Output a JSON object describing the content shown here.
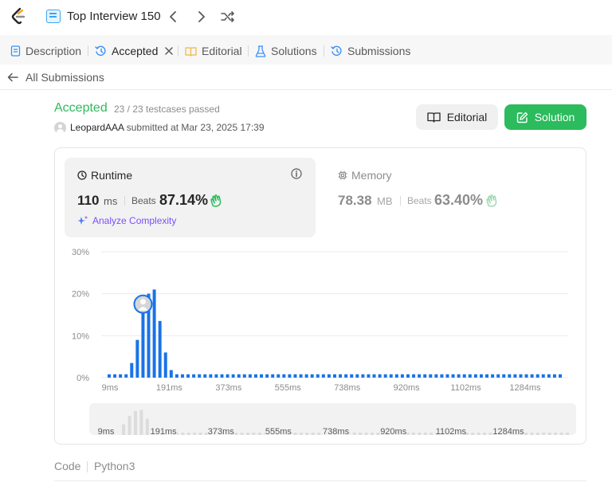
{
  "header": {
    "list_title": "Top Interview 150"
  },
  "tabs": [
    {
      "label": "Description",
      "color": "#3b8ff5"
    },
    {
      "label": "Accepted",
      "color": "#3b8ff5"
    },
    {
      "label": "Editorial",
      "color": "#f5b441"
    },
    {
      "label": "Solutions",
      "color": "#3b8ff5"
    },
    {
      "label": "Submissions",
      "color": "#3b8ff5"
    }
  ],
  "subbar": {
    "back_label": "All Submissions"
  },
  "result": {
    "status": "Accepted",
    "testcases": "23 / 23 testcases passed",
    "username": "LeopardAAA",
    "submitted": "submitted at Mar 23, 2025 17:39",
    "editorial_button": "Editorial",
    "solution_button": "Solution"
  },
  "runtime": {
    "title": "Runtime",
    "value": "110",
    "unit": "ms",
    "beats_label": "Beats",
    "beats_pct": "87.14%",
    "analyze_label": "Analyze Complexity"
  },
  "memory": {
    "title": "Memory",
    "value": "78.38",
    "unit": "MB",
    "beats_label": "Beats",
    "beats_pct": "63.40%"
  },
  "code": {
    "label": "Code",
    "language": "Python3"
  },
  "colors": {
    "accent_green": "#2cbb5d",
    "bar_blue": "#1a73e8"
  },
  "chart_data": {
    "type": "bar",
    "ylim": [
      0,
      30
    ],
    "yticks": [
      "30%",
      "20%",
      "10%",
      "0%"
    ],
    "xticks": [
      "9ms",
      "191ms",
      "373ms",
      "555ms",
      "738ms",
      "920ms",
      "1102ms",
      "1284ms"
    ],
    "values": [
      0.8,
      0.8,
      0.8,
      0.8,
      3.5,
      9,
      16,
      20,
      21,
      13.5,
      6,
      1.8,
      0.8,
      0.8,
      0.8,
      0.8,
      0.8,
      0.8,
      0.8,
      0.8,
      0.8,
      0.8,
      0.8,
      0.8,
      0.8,
      0.8,
      0.8,
      0.8,
      0.8,
      0.8,
      0.8,
      0.8,
      0.8,
      0.8,
      0.8,
      0.8,
      0.8,
      0.8,
      0.8,
      0.8,
      0.8,
      0.8,
      0.8,
      0.8,
      0.8,
      0.8,
      0.8,
      0.8,
      0.8,
      0.8,
      0.8,
      0.8,
      0.8,
      0.8,
      0.8,
      0.8,
      0.8,
      0.8,
      0.8,
      0.8,
      0.8,
      0.8,
      0.8,
      0.8,
      0.8,
      0.8,
      0.8,
      0.8,
      0.8,
      0.8,
      0.8,
      0.8,
      0.8,
      0.8,
      0.8,
      0.8,
      0.8,
      0.8,
      0.8,
      0.8,
      0.8
    ],
    "highlight_index": 6,
    "grid": true
  }
}
